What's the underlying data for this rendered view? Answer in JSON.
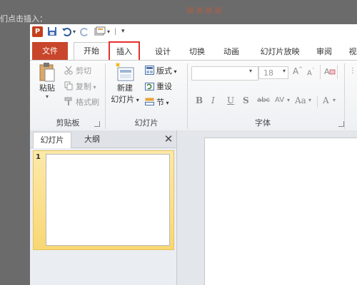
{
  "background": {
    "caption": "们点击插入："
  },
  "app": {
    "icon_letter": "P",
    "brand_color": "#c8462b",
    "highlight_color": "#e3312b"
  },
  "quick_access": {
    "icons": [
      "save-icon",
      "undo-icon",
      "redo-icon",
      "new-slide-icon",
      "customize-icon"
    ]
  },
  "tabs": [
    {
      "label": "文件"
    },
    {
      "label": "开始"
    },
    {
      "label": "插入"
    },
    {
      "label": "设计"
    },
    {
      "label": "切换"
    },
    {
      "label": "动画"
    },
    {
      "label": "幻灯片放映"
    },
    {
      "label": "审阅"
    },
    {
      "label": "视"
    }
  ],
  "ribbon": {
    "clipboard": {
      "paste_label": "粘贴",
      "cut_label": "剪切",
      "copy_label": "复制",
      "format_painter_label": "格式刷",
      "group_label": "剪贴板"
    },
    "slides": {
      "new_slide_label_1": "新建",
      "new_slide_label_2": "幻灯片",
      "layout_label": "版式",
      "reset_label": "重设",
      "section_label": "节",
      "group_label": "幻灯片"
    },
    "font": {
      "size_value": "18",
      "group_label": "字体",
      "bold": "B",
      "italic": "I",
      "underline": "U",
      "shadow": "S",
      "strike": "abc",
      "spacing": "AV",
      "case": "Aa",
      "color": "A"
    }
  },
  "left_pane": {
    "tab_slides": "幻灯片",
    "tab_outline": "大纲",
    "close_glyph": "✕",
    "slide_number": "1"
  }
}
